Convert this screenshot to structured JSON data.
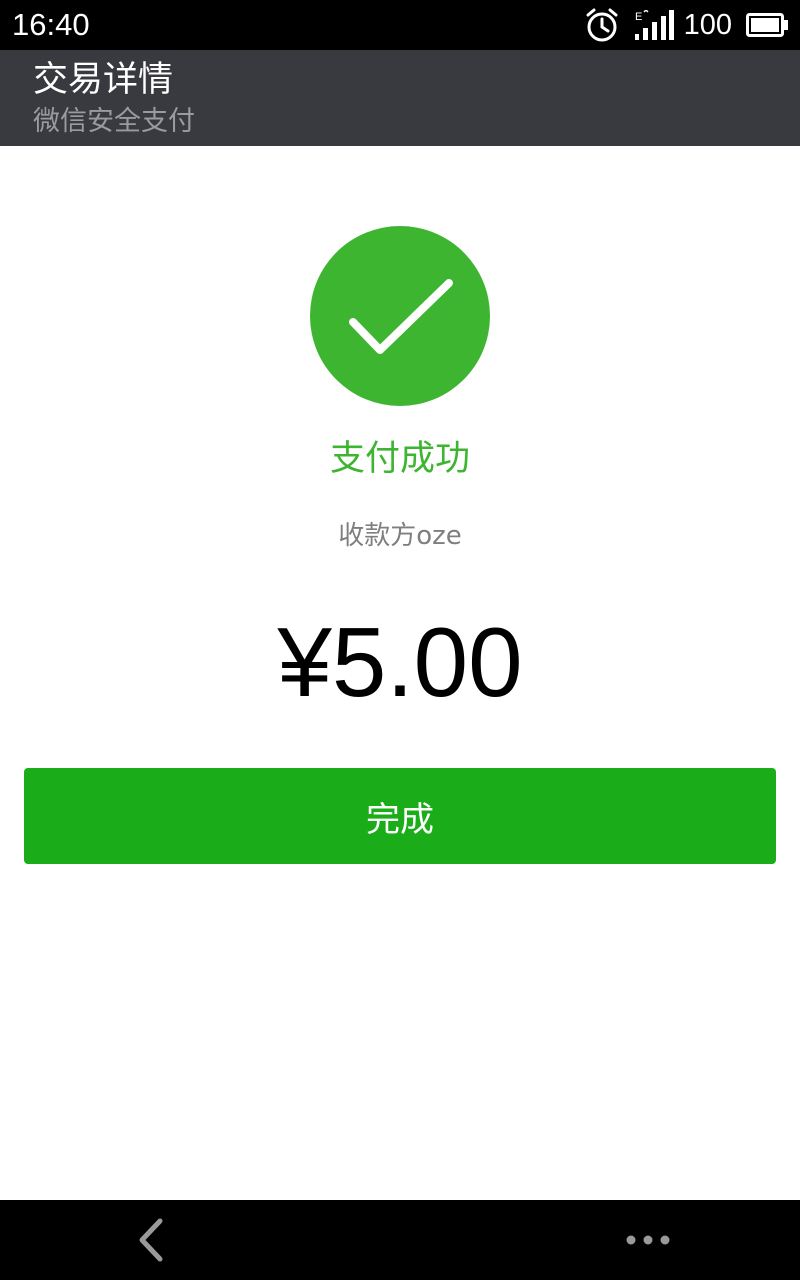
{
  "status_bar": {
    "time": "16:40",
    "battery_level": "100",
    "network_label": "E",
    "icons": [
      "alarm-icon",
      "signal-icon",
      "battery-icon"
    ]
  },
  "header": {
    "title": "交易详情",
    "subtitle": "微信安全支付"
  },
  "result": {
    "icon": "checkmark-icon",
    "status_text": "支付成功",
    "payee_line": "收款方oze",
    "amount": "¥5.00"
  },
  "actions": {
    "done_label": "完成"
  },
  "nav": {
    "icons": [
      "back-icon",
      "more-icon"
    ]
  },
  "colors": {
    "success_green": "#3eb531",
    "button_green": "#1aad19",
    "title_bar_bg": "#393a3f",
    "status_bar_bg": "#000000"
  }
}
